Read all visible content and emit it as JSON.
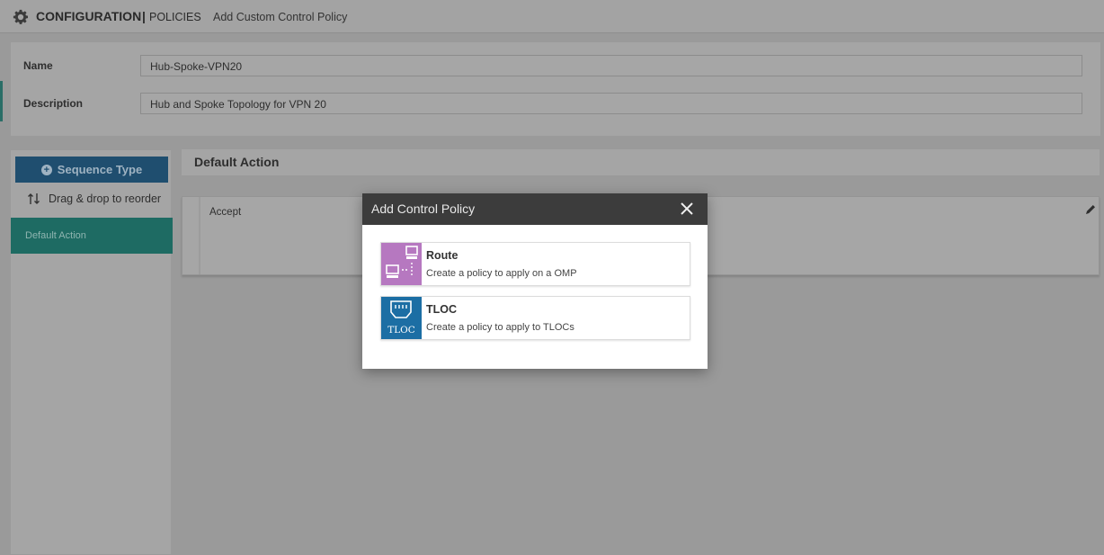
{
  "header": {
    "section": "CONFIGURATION",
    "separator": "|",
    "subsection": "POLICIES",
    "page_title": "Add Custom Control Policy"
  },
  "form": {
    "name_label": "Name",
    "name_value": "Hub-Spoke-VPN20",
    "description_label": "Description",
    "description_value": "Hub and Spoke Topology for VPN 20"
  },
  "sequence_panel": {
    "sequence_type_label": "Sequence Type",
    "drag_label": "Drag & drop to reorder",
    "default_action_item": "Default Action"
  },
  "default_action": {
    "heading": "Default Action",
    "value": "Accept"
  },
  "modal": {
    "title": "Add Control Policy",
    "options": [
      {
        "title": "Route",
        "description": "Create a policy to apply on a OMP",
        "icon": "route-icon",
        "color": "#b678c0"
      },
      {
        "title": "TLOC",
        "description": "Create a policy to apply to TLOCs",
        "icon": "tloc-icon",
        "icon_text": "TLOC",
        "color": "#1c6ea4"
      }
    ]
  },
  "colors": {
    "sequence_button": "#1f4e6f",
    "default_action_item": "#1e6b63",
    "modal_header": "#3c3c3c"
  }
}
